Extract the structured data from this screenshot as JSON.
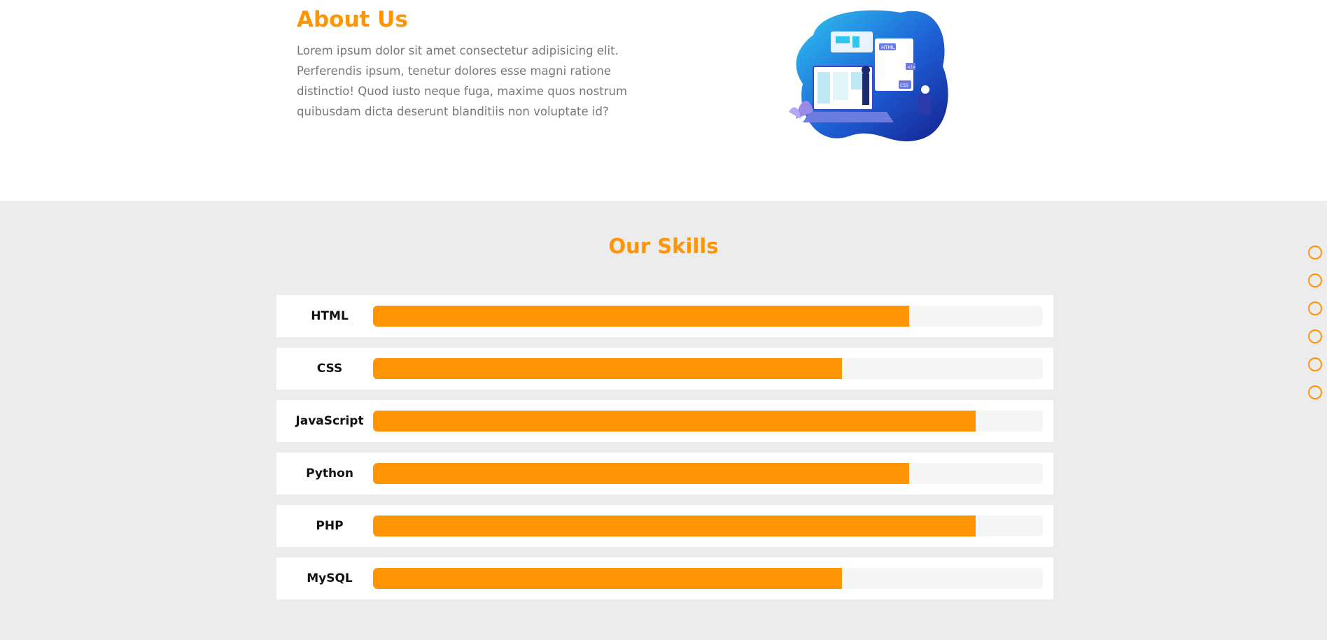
{
  "settings": {
    "icon": "gear-icon"
  },
  "about": {
    "title": "About Us",
    "text": "Lorem ipsum dolor sit amet consectetur adipisicing elit. Perferendis ipsum, tenetur dolores esse magni ratione distinctio! Quod iusto neque fuga, maxime quos nostrum quibusdam dicta deserunt blanditiis non voluptate id?",
    "image_badges": [
      "HTML",
      "CSS",
      "</>"
    ]
  },
  "skills": {
    "title": "Our Skills",
    "items": [
      {
        "name": "HTML",
        "percent": 80
      },
      {
        "name": "CSS",
        "percent": 70
      },
      {
        "name": "JavaScript",
        "percent": 90
      },
      {
        "name": "Python",
        "percent": 80
      },
      {
        "name": "PHP",
        "percent": 90
      },
      {
        "name": "MySQL",
        "percent": 70
      }
    ]
  },
  "side_nav": {
    "count": 6
  },
  "colors": {
    "accent": "#ff9505",
    "section_bg": "#ececec",
    "track_bg": "#f5f5f5",
    "text_muted": "#777777",
    "illustration_blue": "#1e5fd6",
    "illustration_light": "#2ec5f0"
  }
}
